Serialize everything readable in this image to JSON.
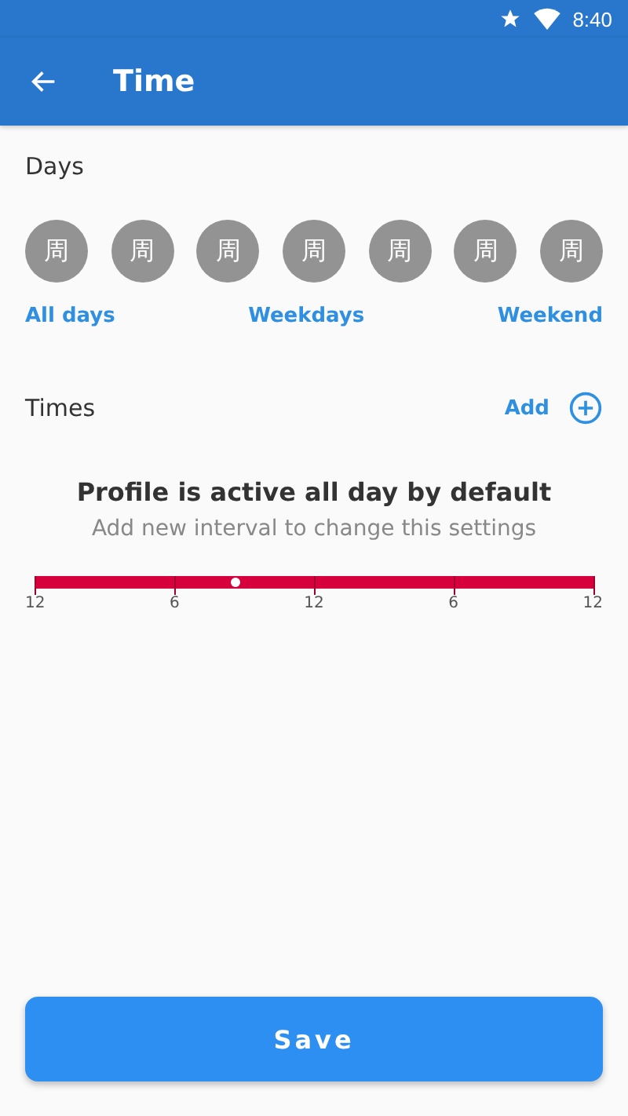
{
  "status_bar": {
    "time": "8:40"
  },
  "app_bar": {
    "title": "Time"
  },
  "days": {
    "label": "Days",
    "items": [
      {
        "label": "周",
        "selected": false
      },
      {
        "label": "周",
        "selected": false
      },
      {
        "label": "周",
        "selected": false
      },
      {
        "label": "周",
        "selected": false
      },
      {
        "label": "周",
        "selected": false
      },
      {
        "label": "周",
        "selected": false
      },
      {
        "label": "周",
        "selected": false
      }
    ],
    "presets": [
      "All days",
      "Weekdays",
      "Weekend"
    ]
  },
  "times": {
    "label": "Times",
    "add": "Add"
  },
  "empty_state": {
    "title": "Profile is active all day by default",
    "subtitle": "Add new interval to change this settings"
  },
  "timeline": {
    "level": 0.36,
    "ticks": [
      "12",
      "6",
      "12",
      "6",
      "12"
    ]
  },
  "save_button": "Save"
}
